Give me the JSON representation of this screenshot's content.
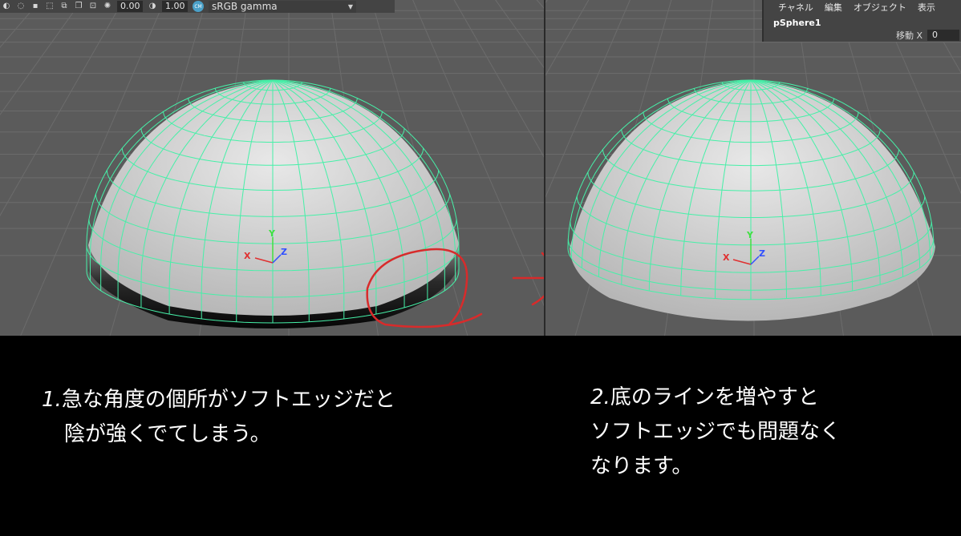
{
  "toolbar": {
    "exposure_value": "0.00",
    "gamma_value": "1.00",
    "colorspace_label": "sRGB gamma",
    "icons": [
      "shading-icon",
      "circle-icon",
      "square-icon",
      "select-icon",
      "copy-icon",
      "layer-icon",
      "frame-icon",
      "aperture-icon",
      "gamma-icon",
      "colorspace-icon"
    ]
  },
  "channel_box": {
    "menu": [
      "チャネル",
      "編集",
      "オブジェクト",
      "表示"
    ],
    "object_name": "pSphere1",
    "attr_label": "移動 X",
    "attr_value": "0"
  },
  "viewport_left": {
    "axis_x": "X",
    "axis_y": "Y",
    "axis_z": "Z"
  },
  "viewport_right": {
    "axis_x": "X",
    "axis_y": "Y",
    "axis_z": "Z"
  },
  "captions": {
    "one_num": "1.",
    "one_line1": "急な角度の個所がソフトエッジだと",
    "one_line2": "陰が強くでてしまう。",
    "two_num": "2.",
    "two_line1": "底のラインを増やすと",
    "two_line2": "ソフトエッジでも問題なく",
    "two_line3": "なります。"
  },
  "colors": {
    "viewport_bg": "#5b5b5b",
    "grid": "#6c6c6c",
    "wire": "#46f0a8",
    "annotation": "#d82b2b",
    "axis_x": "#e03030",
    "axis_y": "#40e040",
    "axis_z": "#3050ff"
  }
}
